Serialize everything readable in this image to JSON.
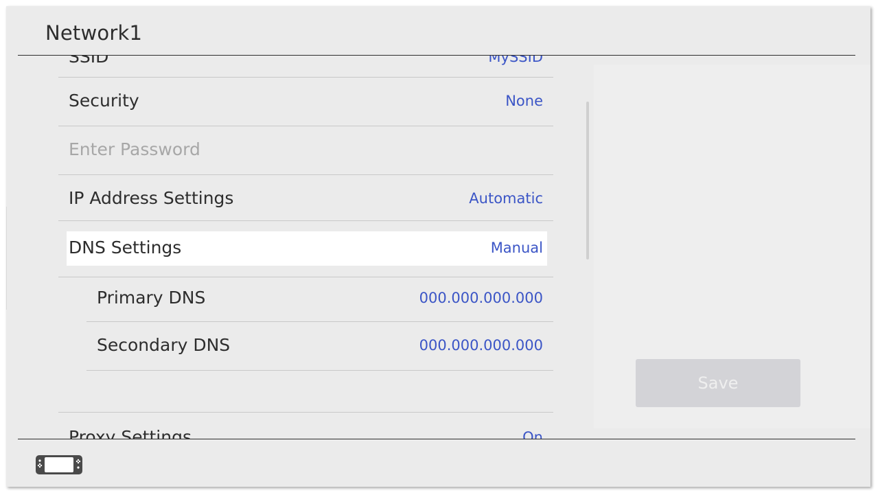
{
  "header": {
    "title": "Network1"
  },
  "settings": {
    "ssid": {
      "label": "SSID",
      "value": "MySSID"
    },
    "security": {
      "label": "Security",
      "value": "None"
    },
    "password": {
      "label": "Enter Password"
    },
    "ip": {
      "label": "IP Address Settings",
      "value": "Automatic"
    },
    "dns": {
      "label": "DNS Settings",
      "value": "Manual"
    },
    "primary_dns": {
      "label": "Primary DNS",
      "value": "000.000.000.000"
    },
    "secondary_dns": {
      "label": "Secondary DNS",
      "value": "000.000.000.000"
    },
    "proxy": {
      "label": "Proxy Settings",
      "value": "On"
    }
  },
  "actions": {
    "save_label": "Save"
  },
  "footer": {
    "icon": "handheld-console-icon"
  },
  "colors": {
    "value_text": "#3b55c6",
    "background": "#ebebeb",
    "disabled_text": "#a7a7a7"
  }
}
